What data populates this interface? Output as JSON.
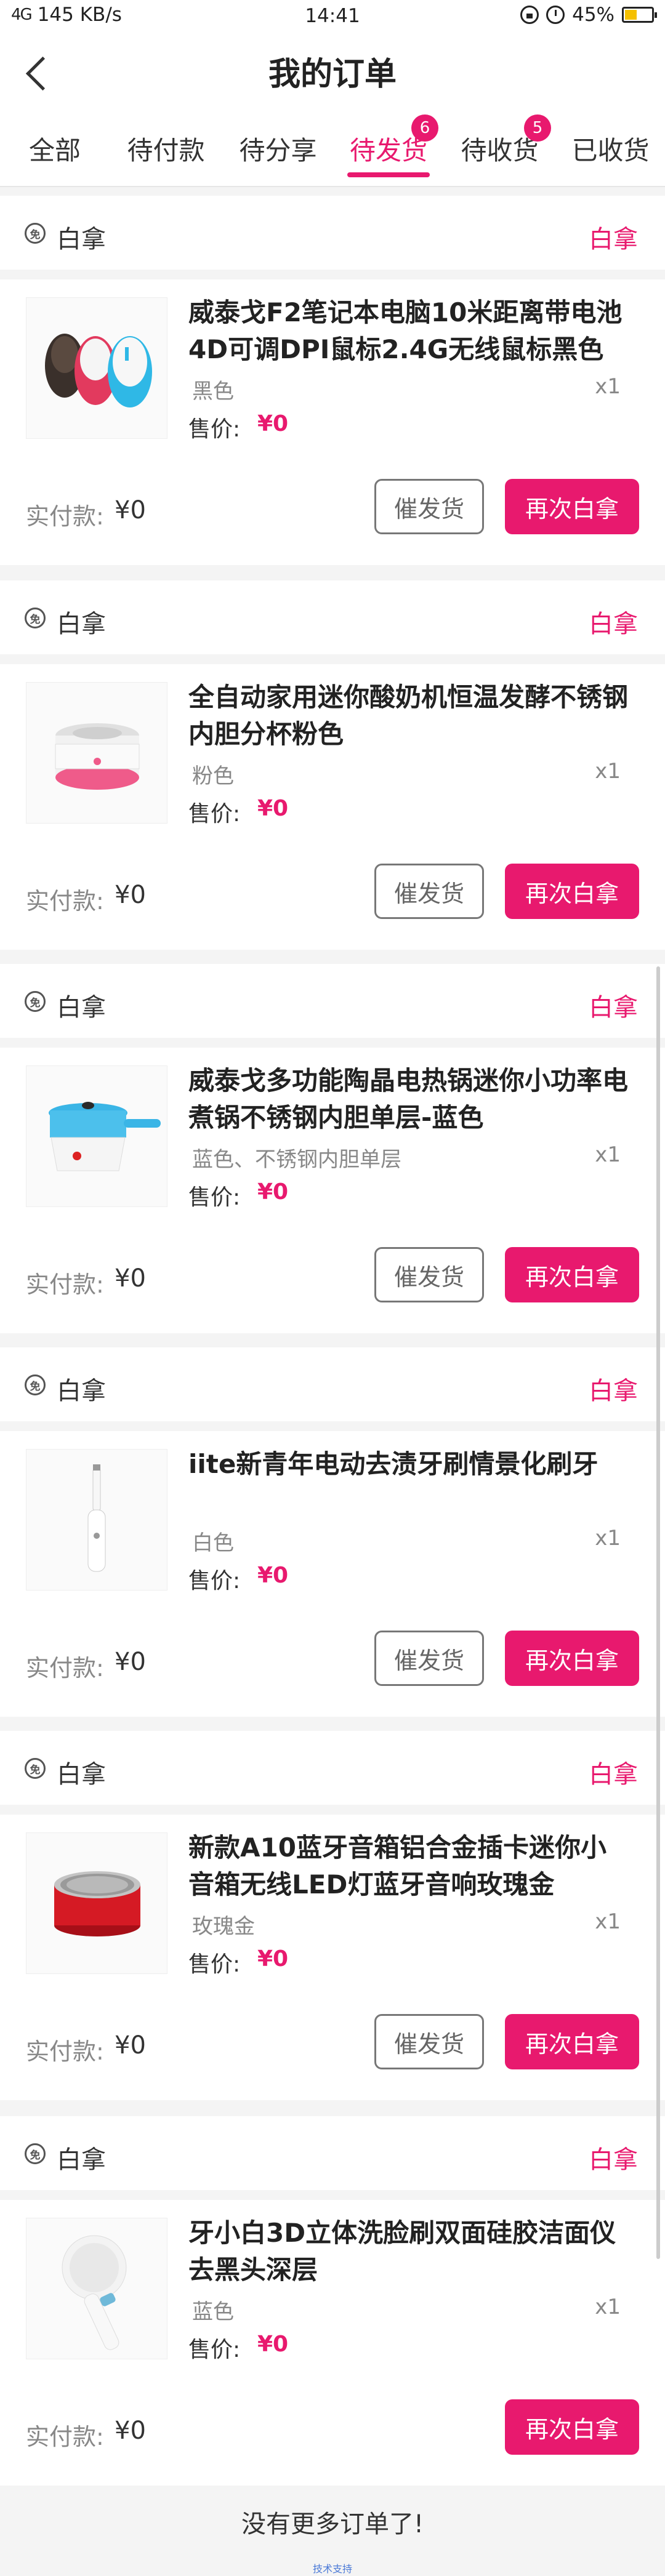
{
  "status_bar": {
    "network": "4G",
    "speed": "145 KB/s",
    "time": "14:41",
    "battery": "45%",
    "battery_level": 0.45
  },
  "header": {
    "title": "我的订单"
  },
  "tabs": [
    {
      "label": "全部",
      "badge": null,
      "active": false
    },
    {
      "label": "待付款",
      "badge": null,
      "active": false
    },
    {
      "label": "待分享",
      "badge": null,
      "active": false
    },
    {
      "label": "待发货",
      "badge": "6",
      "active": true
    },
    {
      "label": "待收货",
      "badge": "5",
      "active": false
    },
    {
      "label": "已收货",
      "badge": null,
      "active": false
    }
  ],
  "orders": [
    {
      "shop": "白拿",
      "shop_icon": "免",
      "status": "白拿",
      "product_name": "威泰戈F2笔记本电脑10米距离带电池4D可调DPI鼠标2.4G无线鼠标黑色",
      "variant": "黑色",
      "qty": "x1",
      "price_label": "售价:",
      "price": "¥0",
      "paid_label": "实付款:",
      "paid": "¥0",
      "remind_label": "催发货",
      "reorder_label": "再次白拿",
      "image_icon": "wireless-mouse"
    },
    {
      "shop": "白拿",
      "shop_icon": "免",
      "status": "白拿",
      "product_name": "全自动家用迷你酸奶机恒温发酵不锈钢内胆分杯粉色",
      "variant": "粉色",
      "qty": "x1",
      "price_label": "售价:",
      "price": "¥0",
      "paid_label": "实付款:",
      "paid": "¥0",
      "remind_label": "催发货",
      "reorder_label": "再次白拿",
      "image_icon": "yogurt-maker"
    },
    {
      "shop": "白拿",
      "shop_icon": "免",
      "status": "白拿",
      "product_name": "威泰戈多功能陶晶电热锅迷你小功率电煮锅不锈钢内胆单层-蓝色",
      "variant": "蓝色、不锈钢内胆单层",
      "qty": "x1",
      "price_label": "售价:",
      "price": "¥0",
      "paid_label": "实付款:",
      "paid": "¥0",
      "remind_label": "催发货",
      "reorder_label": "再次白拿",
      "image_icon": "electric-pot"
    },
    {
      "shop": "白拿",
      "shop_icon": "免",
      "status": "白拿",
      "product_name": "iite新青年电动去渍牙刷情景化刷牙",
      "variant": "白色",
      "qty": "x1",
      "price_label": "售价:",
      "price": "¥0",
      "paid_label": "实付款:",
      "paid": "¥0",
      "remind_label": "催发货",
      "reorder_label": "再次白拿",
      "image_icon": "electric-toothbrush"
    },
    {
      "shop": "白拿",
      "shop_icon": "免",
      "status": "白拿",
      "product_name": "新款A10蓝牙音箱铝合金插卡迷你小音箱无线LED灯蓝牙音响玫瑰金",
      "variant": "玫瑰金",
      "qty": "x1",
      "price_label": "售价:",
      "price": "¥0",
      "paid_label": "实付款:",
      "paid": "¥0",
      "remind_label": "催发货",
      "reorder_label": "再次白拿",
      "image_icon": "bluetooth-speaker"
    },
    {
      "shop": "白拿",
      "shop_icon": "免",
      "status": "白拿",
      "product_name": "牙小白3D立体洗脸刷双面硅胶洁面仪去黑头深层",
      "variant": "蓝色",
      "qty": "x1",
      "price_label": "售价:",
      "price": "¥0",
      "paid_label": "实付款:",
      "paid": "¥0",
      "remind_label": null,
      "reorder_label": "再次白拿",
      "image_icon": "face-brush"
    }
  ],
  "footer": {
    "text": "没有更多订单了!",
    "sub": "技术支持"
  },
  "colors": {
    "accent": "#e8196e",
    "bg": "#f4f4f4"
  }
}
